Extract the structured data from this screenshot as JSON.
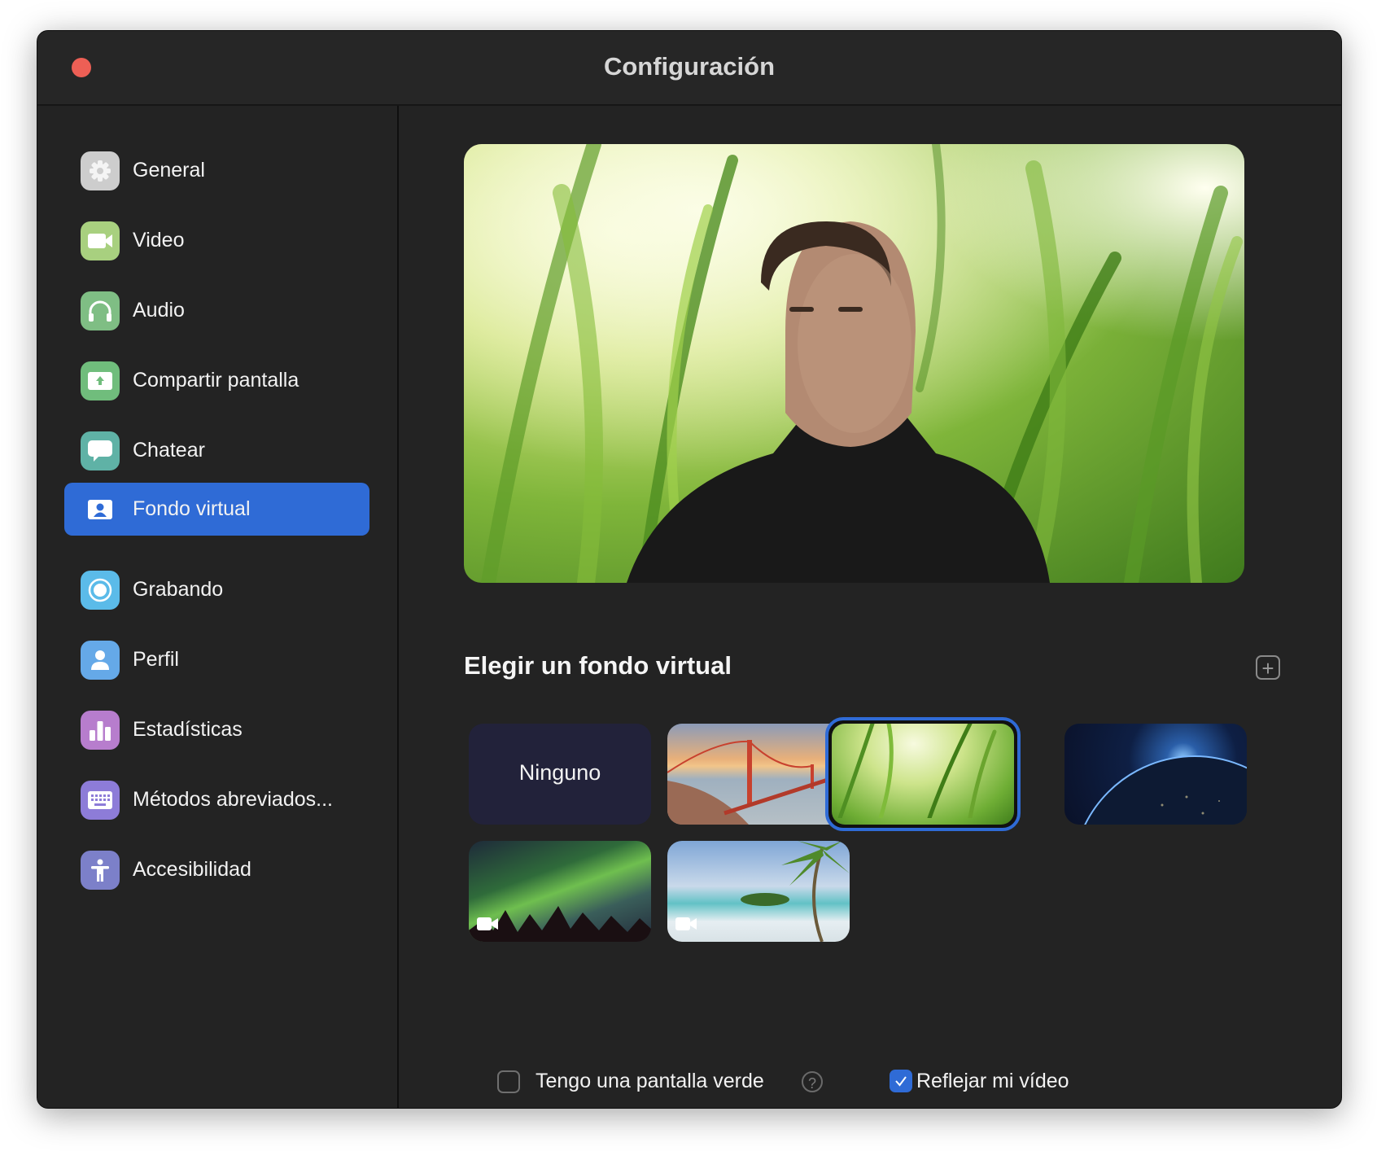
{
  "window": {
    "title": "Configuración"
  },
  "sidebar": {
    "items": [
      {
        "label": "General",
        "icon": "gear-icon",
        "color": "#cdcdcd"
      },
      {
        "label": "Video",
        "icon": "video-camera-icon",
        "color": "#a8d07f"
      },
      {
        "label": "Audio",
        "icon": "headphones-icon",
        "color": "#7fbe84"
      },
      {
        "label": "Compartir pantalla",
        "icon": "share-screen-icon",
        "color": "#70bd7c"
      },
      {
        "label": "Chatear",
        "icon": "chat-bubble-icon",
        "color": "#5fb2a6"
      },
      {
        "label": "Fondo virtual",
        "icon": "virtual-background-icon",
        "color": "#2f6bd6"
      },
      {
        "label": "Grabando",
        "icon": "record-icon",
        "color": "#5bbbe9"
      },
      {
        "label": "Perfil",
        "icon": "profile-icon",
        "color": "#65a9e8"
      },
      {
        "label": "Estadísticas",
        "icon": "bar-chart-icon",
        "color": "#b77dcd"
      },
      {
        "label": "Métodos abreviados...",
        "icon": "keyboard-icon",
        "color": "#8d7cd8"
      },
      {
        "label": "Accesibilidad",
        "icon": "accessibility-icon",
        "color": "#7c80c9"
      }
    ],
    "active_index": 5
  },
  "main": {
    "section_title": "Elegir un fondo virtual",
    "add_icon": "plus-icon",
    "backgrounds": [
      {
        "label": "Ninguno",
        "kind": "none"
      },
      {
        "kind": "image",
        "theme": "golden-gate-bridge"
      },
      {
        "kind": "image",
        "theme": "grass",
        "selected": true
      },
      {
        "kind": "image",
        "theme": "earth-from-space"
      },
      {
        "kind": "video",
        "theme": "aurora"
      },
      {
        "kind": "video",
        "theme": "beach-palm"
      }
    ],
    "green_screen": {
      "label": "Tengo una pantalla verde",
      "checked": false
    },
    "mirror": {
      "label": "Reflejar mi vídeo",
      "checked": true
    },
    "help_icon": "question-icon"
  },
  "colors": {
    "accent": "#2f6bd6",
    "window_bg": "#232323",
    "close": "#ed5f55"
  }
}
